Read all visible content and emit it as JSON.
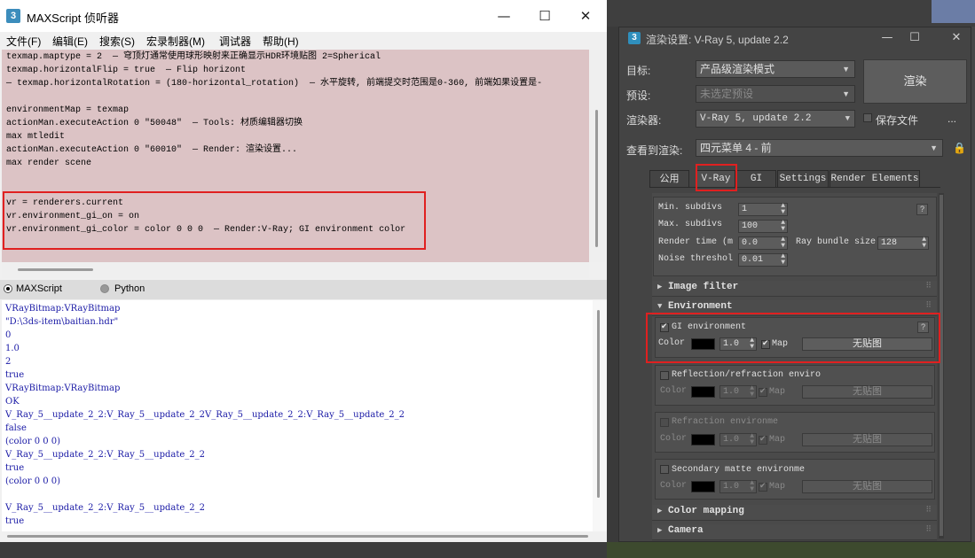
{
  "listener": {
    "title": "MAXScript 侦听器",
    "app_icon_glyph": "3",
    "menu": [
      "文件(F)",
      "编辑(E)",
      "搜索(S)",
      "宏录制器(M)",
      "调试器",
      "帮助(H)"
    ],
    "macro_lines": [
      "texmap.maptype = 2  — 穹顶灯通常使用球形映射来正确显示HDR环境贴图 2=Spherical",
      "texmap.horizontalFlip = true  — Flip horizont",
      "— texmap.horizontalRotation = (180-horizontal_rotation)  — 水平旋转, 前端提交时范围是0-360, 前端如果设置是-",
      "",
      "environmentMap = texmap",
      "actionMan.executeAction 0 \"50048\"  — Tools: 材质编辑器切换",
      "max mtledit",
      "actionMan.executeAction 0 \"60010\"  — Render: 渲染设置...",
      "max render scene",
      "",
      "",
      "vr = renderers.current",
      "vr.environment_gi_on = on",
      "vr.environment_gi_color = color 0 0 0  — Render:V-Ray; GI environment color"
    ],
    "languages": {
      "maxscript": "MAXScript",
      "python": "Python"
    },
    "output_lines": [
      "VRayBitmap:VRayBitmap",
      "\"D:\\3ds-item\\baitian.hdr\"",
      "0",
      "1.0",
      "2",
      "true",
      "VRayBitmap:VRayBitmap",
      "OK",
      "V_Ray_5__update_2_2:V_Ray_5__update_2_2V_Ray_5__update_2_2:V_Ray_5__update_2_2",
      "false",
      "(color 0 0 0)",
      "V_Ray_5__update_2_2:V_Ray_5__update_2_2",
      "true",
      "(color 0 0 0)",
      "",
      "V_Ray_5__update_2_2:V_Ray_5__update_2_2",
      "true"
    ]
  },
  "render": {
    "title": "渲染设置: V-Ray 5, update 2.2",
    "app_icon_glyph": "3",
    "target_label": "目标:",
    "target_value": "产品级渲染模式",
    "preset_label": "预设:",
    "preset_value": "未选定预设",
    "renderer_label": "渲染器:",
    "renderer_value": "V-Ray 5, update 2.2",
    "save_file_label": "保存文件",
    "more_label": "...",
    "view_label": "查看到渲染:",
    "view_value": "四元菜单 4 - 前",
    "render_button": "渲染",
    "tabs": [
      "公用",
      "V-Ray",
      "GI",
      "Settings",
      "Render Elements"
    ],
    "sampler": {
      "min_subdivs_label": "Min. subdivs",
      "min_subdivs": "1",
      "max_subdivs_label": "Max. subdivs",
      "max_subdivs": "100",
      "render_time_label": "Render time (m",
      "render_time": "0.0",
      "ray_bundle_label": "Ray bundle size",
      "ray_bundle": "128",
      "noise_label": "Noise threshol",
      "noise": "0.01",
      "help": "?"
    },
    "rollouts": {
      "image_filter": "Image filter",
      "environment": "Environment",
      "color_mapping": "Color mapping",
      "camera": "Camera"
    },
    "environment": {
      "gi": {
        "label": "GI environment",
        "color_label": "Color",
        "multiplier": "1.0",
        "map_label": "Map",
        "map_button": "无贴图",
        "help": "?"
      },
      "reflection": {
        "label": "Reflection/refraction enviro",
        "color_label": "Color",
        "multiplier": "1.0",
        "map_label": "Map",
        "map_button": "无贴图"
      },
      "refraction": {
        "label": "Refraction environme",
        "color_label": "Color",
        "multiplier": "1.0",
        "map_label": "Map",
        "map_button": "无贴图"
      },
      "secondary": {
        "label": "Secondary matte environme",
        "color_label": "Color",
        "multiplier": "1.0",
        "map_label": "Map",
        "map_button": "无贴图"
      }
    }
  },
  "colors": {
    "highlight_red": "#e02020",
    "macro_bg": "#dcc3c5",
    "output_text": "#1a1aa6"
  }
}
